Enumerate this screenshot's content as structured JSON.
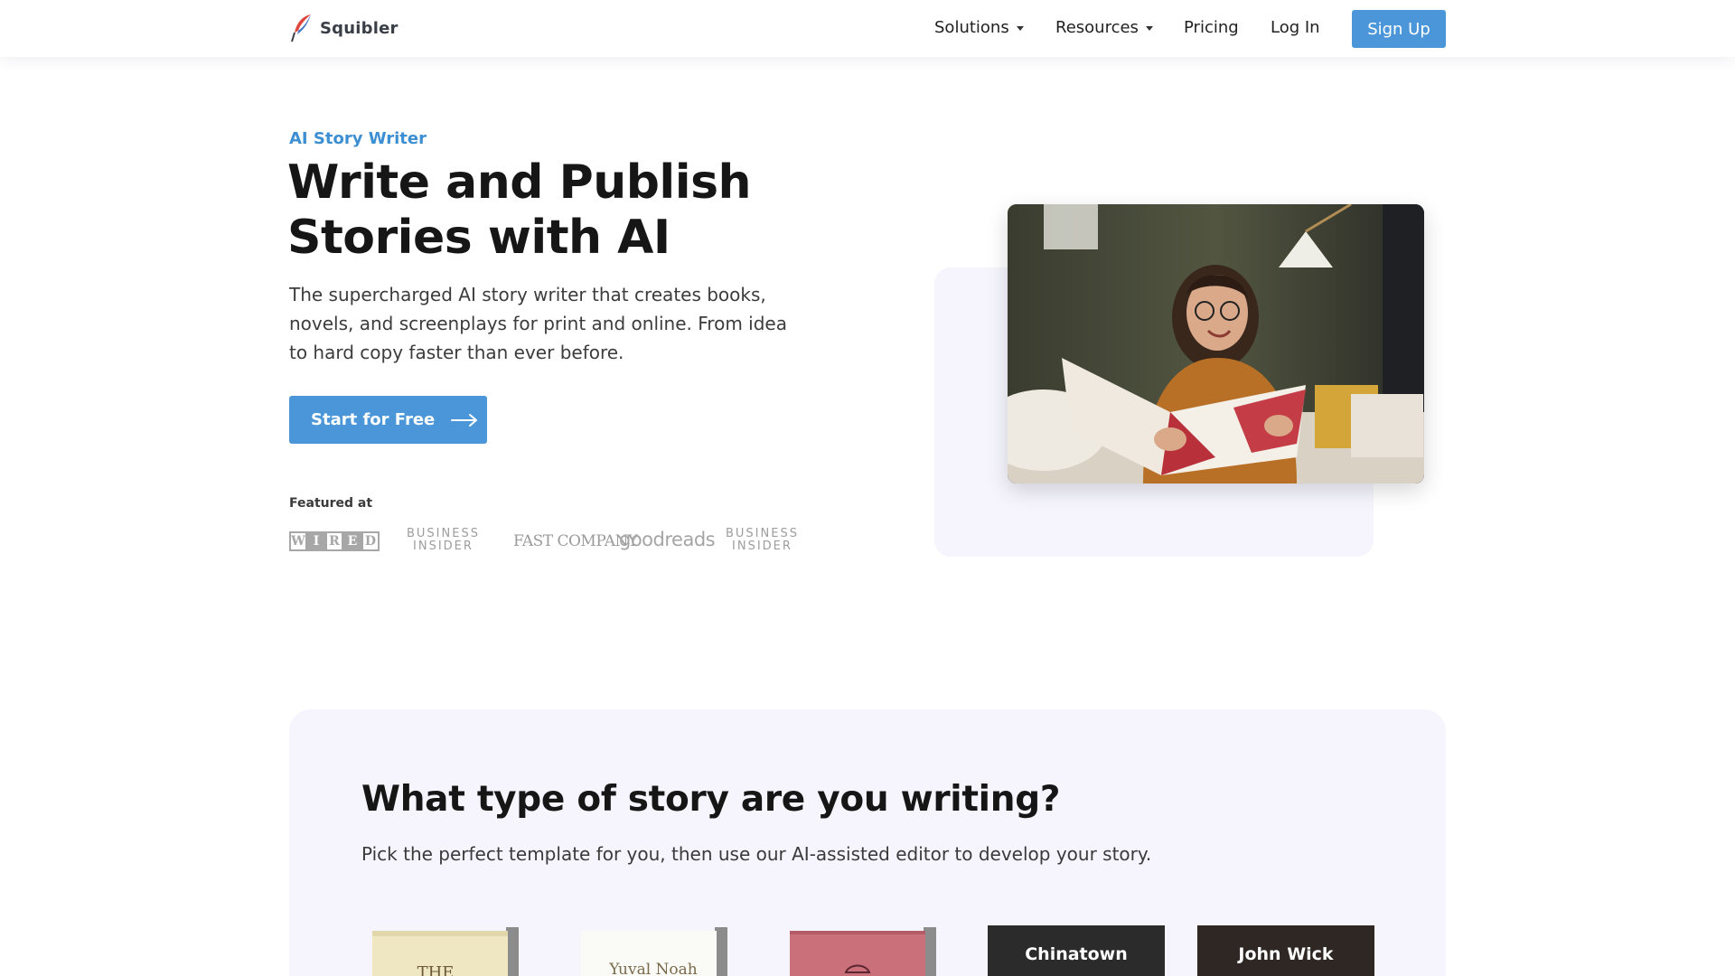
{
  "brand": {
    "name": "Squibler"
  },
  "nav": {
    "items": [
      {
        "label": "Solutions",
        "dropdown": true
      },
      {
        "label": "Resources",
        "dropdown": true
      },
      {
        "label": "Pricing",
        "dropdown": false
      },
      {
        "label": "Log In",
        "dropdown": false
      }
    ],
    "signup_label": "Sign Up"
  },
  "hero": {
    "eyebrow": "AI Story Writer",
    "title_line1": "Write and Publish",
    "title_line2": "Stories with AI",
    "subtitle": "The supercharged AI story writer that creates books, novels, and screenplays for print and online. From idea to hard copy faster than ever before.",
    "cta_label": "Start for Free",
    "featured_label": "Featured at",
    "press": {
      "wired": [
        "W",
        "I",
        "R",
        "E",
        "D"
      ],
      "business_insider_1": [
        "BUSINESS",
        "INSIDER"
      ],
      "fast_company": "FAST COMPANY",
      "goodreads": "goodreads",
      "business_insider_2": [
        "BUSINESS",
        "INSIDER"
      ]
    }
  },
  "templates": {
    "title": "What type of story are you writing?",
    "subtitle": "Pick the perfect template for you, then use our AI-assisted editor to develop your story.",
    "cards": [
      {
        "kind": "book",
        "cover_text": "THE"
      },
      {
        "kind": "book",
        "cover_text": "Yuval Noah"
      },
      {
        "kind": "book",
        "cover_text": ""
      },
      {
        "kind": "movie",
        "label": "Chinatown"
      },
      {
        "kind": "movie",
        "label": "John Wick"
      }
    ]
  },
  "colors": {
    "accent": "#4a96d8",
    "panel": "#f6f5fd",
    "heading": "#161616"
  },
  "icons": {
    "logo": "quill-feather-icon",
    "cta": "arrow-right-icon"
  }
}
